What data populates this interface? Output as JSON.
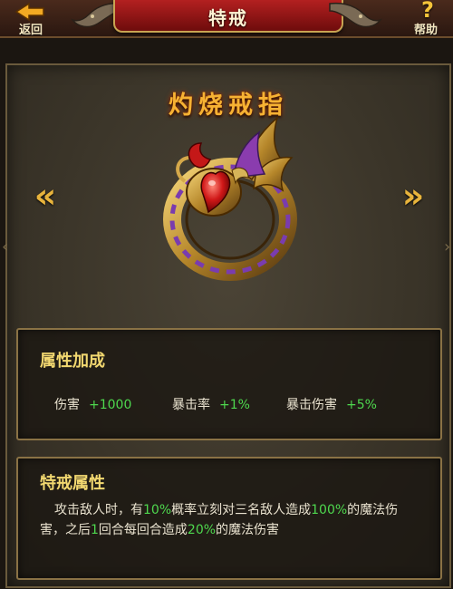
{
  "header": {
    "title": "特戒",
    "back_label": "返回",
    "help_label": "帮助",
    "help_glyph": "?"
  },
  "item": {
    "name": "灼烧戒指",
    "prev_glyph": "«",
    "next_glyph": "»"
  },
  "attributes": {
    "heading": "属性加成",
    "stats": [
      {
        "label": "伤害",
        "value": "+1000"
      },
      {
        "label": "暴击率",
        "value": "+1%"
      },
      {
        "label": "暴击伤害",
        "value": "+5%"
      }
    ]
  },
  "special": {
    "heading": "特戒属性",
    "segments": [
      {
        "text": "攻击敌人时，有",
        "highlight": false
      },
      {
        "text": "10%",
        "highlight": true
      },
      {
        "text": "概率立刻对三名敌人造成",
        "highlight": false
      },
      {
        "text": "100%",
        "highlight": true
      },
      {
        "text": "的魔法伤害，之后",
        "highlight": false
      },
      {
        "text": "1",
        "highlight": true
      },
      {
        "text": "回合每回合造成",
        "highlight": false
      },
      {
        "text": "20%",
        "highlight": true
      },
      {
        "text": "的魔法伤害",
        "highlight": false
      }
    ]
  },
  "colors": {
    "accent_gold": "#f6b233",
    "value_green": "#4ed84e",
    "title_red": "#b32020"
  }
}
